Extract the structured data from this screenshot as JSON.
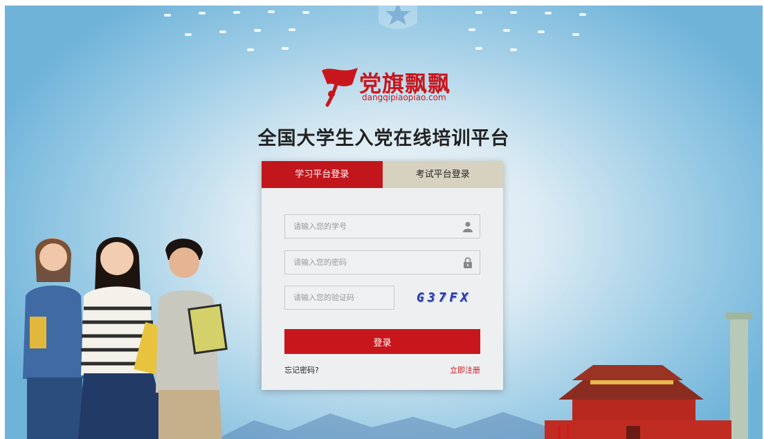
{
  "brand": {
    "name": "党旗飘飘",
    "url": "dangqipiaopiao.com",
    "color": "#c8161d"
  },
  "page_title": "全国大学生入党在线培训平台",
  "tabs": [
    {
      "label": "学习平台登录",
      "active": true
    },
    {
      "label": "考试平台登录",
      "active": false
    }
  ],
  "form": {
    "student_id_placeholder": "请输入您的学号",
    "password_placeholder": "请输入您的密码",
    "captcha_placeholder": "请输入您的验证码",
    "captcha_code": "G37FX",
    "login_label": "登录",
    "forgot_label": "忘记密码?",
    "register_label": "立即注册"
  },
  "icons": {
    "student_id": "user-icon",
    "password": "lock-icon"
  }
}
